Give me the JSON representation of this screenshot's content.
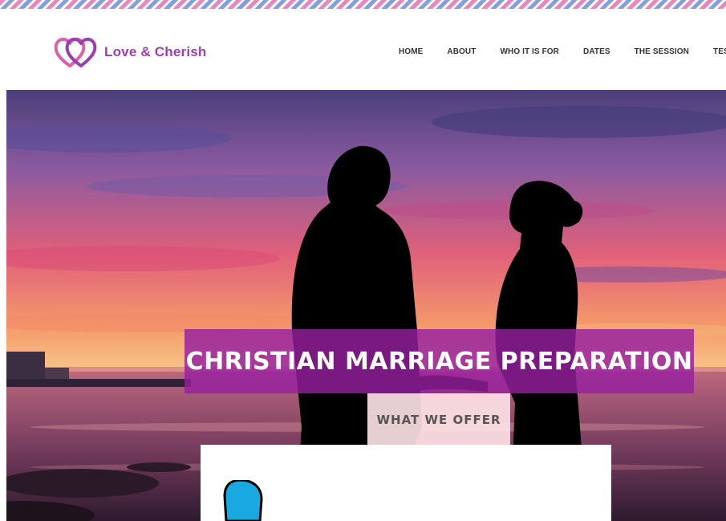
{
  "brand": {
    "name": "Love & Cherish",
    "logo_icon": "double-heart-icon",
    "color": "#9b3fb0",
    "accent": "#e05fa8"
  },
  "nav": {
    "items": [
      {
        "label": "HOME"
      },
      {
        "label": "ABOUT"
      },
      {
        "label": "WHO IT IS FOR"
      },
      {
        "label": "DATES"
      },
      {
        "label": "THE SESSION"
      },
      {
        "label": "TESTIMO"
      }
    ]
  },
  "hero": {
    "image": "sunset-couple-silhouette",
    "title": "CHRISTIAN MARRIAGE PREPARATION",
    "cta_label": "WHAT WE OFFER",
    "banner_color": "#961ea0"
  },
  "widget": {
    "icon": "blue-bubble-icon",
    "icon_color": "#1aa8e0"
  }
}
